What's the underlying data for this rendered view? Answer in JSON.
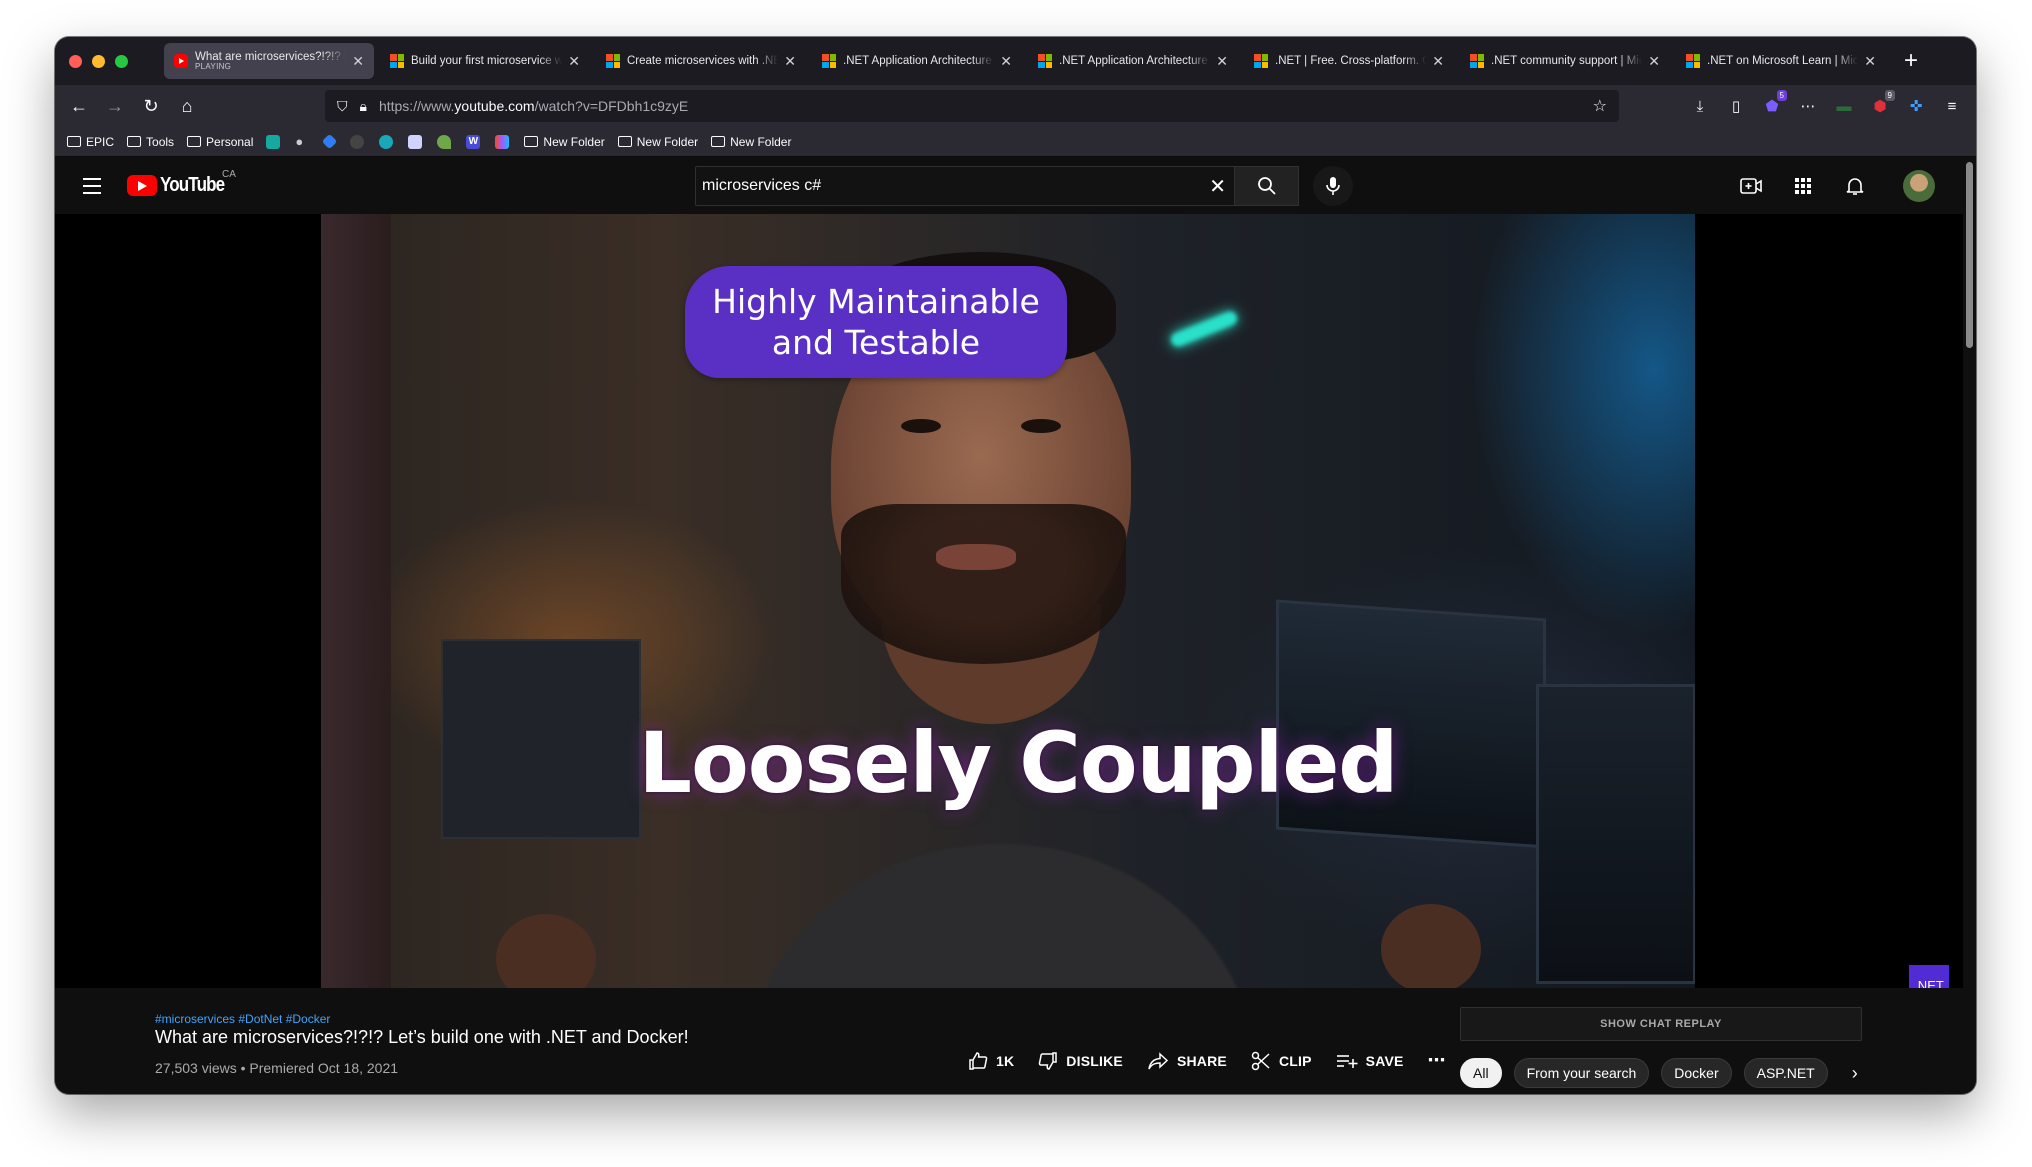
{
  "browser": {
    "tabs": [
      {
        "title": "What are microservices?!?!? Le",
        "subtitle": "PLAYING",
        "favicon": "youtube",
        "active": true
      },
      {
        "title": "Build your first microservice wi",
        "favicon": "microsoft",
        "active": false
      },
      {
        "title": "Create microservices with .NE",
        "favicon": "microsoft",
        "active": false
      },
      {
        "title": ".NET Application Architecture",
        "favicon": "microsoft",
        "active": false
      },
      {
        "title": ".NET Application Architecture",
        "favicon": "microsoft",
        "active": false
      },
      {
        "title": ".NET | Free. Cross-platform. O",
        "favicon": "microsoft",
        "active": false
      },
      {
        "title": ".NET community support | Mic",
        "favicon": "microsoft",
        "active": false
      },
      {
        "title": ".NET on Microsoft Learn | Mic",
        "favicon": "microsoft",
        "active": false
      }
    ],
    "url_prefix": "https://www.",
    "url_domain": "youtube.com",
    "url_path": "/watch?v=DFDbh1c9zyE",
    "extension_badges": [
      "5",
      "9"
    ],
    "bookmarks": {
      "folders_left": [
        "EPIC",
        "Tools",
        "Personal"
      ],
      "folders_right": [
        "New Folder",
        "New Folder",
        "New Folder"
      ]
    }
  },
  "youtube": {
    "logo_text": "YouTube",
    "region": "CA",
    "search_value": "microservices c#",
    "video": {
      "caption_top_line1": "Highly Maintainable",
      "caption_top_line2": "and Testable",
      "caption_main": "Loosely Coupled",
      "channel_badge": ".NET"
    },
    "hashtags": "#microservices #DotNet #Docker",
    "title": "What are microservices?!?!? Let’s build one with .NET and Docker!",
    "meta": "27,503 views • Premiered Oct 18, 2021",
    "actions": {
      "like": "1K",
      "dislike": "DISLIKE",
      "share": "SHARE",
      "clip": "CLIP",
      "save": "SAVE"
    },
    "chat_replay": "SHOW CHAT REPLAY",
    "chips": [
      "All",
      "From your search",
      "Docker",
      "ASP.NET"
    ]
  },
  "colors": {
    "youtube_red": "#ff0000",
    "dotnet_purple": "#512bd4",
    "link_blue": "#3ea6ff",
    "caption_purple": "#5a2fc4"
  }
}
